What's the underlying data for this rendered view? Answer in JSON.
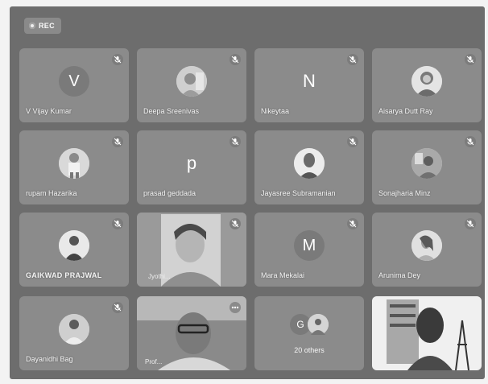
{
  "meeting": {
    "rec_label": "REC",
    "participants": [
      {
        "name": "V Vijay Kumar",
        "avatar_type": "letter",
        "initial": "V"
      },
      {
        "name": "Deepa Sreenivas",
        "avatar_type": "photo"
      },
      {
        "name": "Nikeytaa",
        "avatar_type": "plain",
        "initial": "N"
      },
      {
        "name": "Aisarya Dutt Ray",
        "avatar_type": "photo"
      },
      {
        "name": "rupam Hazarika",
        "avatar_type": "photo"
      },
      {
        "name": "prasad geddada",
        "avatar_type": "plain",
        "initial": "p"
      },
      {
        "name": "Jayasree Subramanian",
        "avatar_type": "photo"
      },
      {
        "name": "Sonajharia Minz",
        "avatar_type": "photo"
      },
      {
        "name": "GAIKWAD PRAJWAL",
        "avatar_type": "photo"
      },
      {
        "name": "",
        "avatar_type": "video"
      },
      {
        "name": "Mara Mekalai",
        "avatar_type": "letter",
        "initial": "M"
      },
      {
        "name": "Arunima Dey",
        "avatar_type": "photo"
      },
      {
        "name": "Dayanidhi Bag",
        "avatar_type": "photo"
      },
      {
        "name": "",
        "avatar_type": "video"
      },
      {
        "name": "",
        "avatar_type": "others",
        "others_label": "20 others",
        "initial": "G"
      },
      {
        "name": "",
        "avatar_type": "video"
      }
    ]
  },
  "colors": {
    "tile": "#8b8b8b",
    "background": "#6d6d6d",
    "avatar": "#7a7a7a"
  }
}
